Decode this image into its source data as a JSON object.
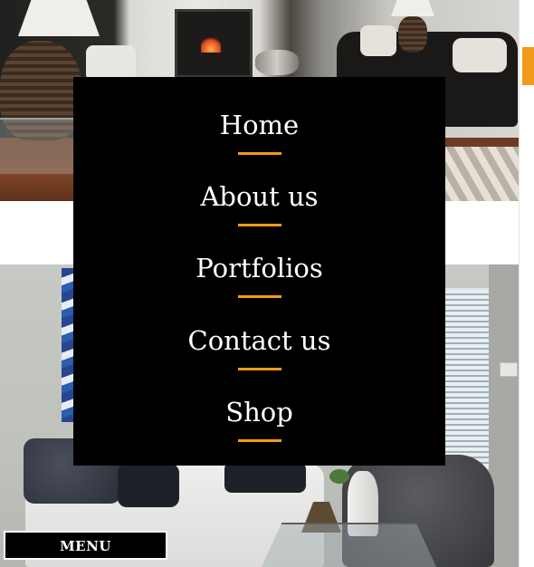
{
  "navigation": {
    "items": [
      {
        "label": "Home"
      },
      {
        "label": "About us"
      },
      {
        "label": "Portfolios"
      },
      {
        "label": "Contact us"
      },
      {
        "label": "Shop"
      }
    ],
    "underline_color": "#f39a1a",
    "background_color": "#000000"
  },
  "menu_toggle": {
    "label": "MENU"
  },
  "scrollbar": {
    "accent_color": "#f39a1a"
  },
  "gallery": {
    "images": [
      {
        "subject": "living-room-fireplace-photo"
      },
      {
        "subject": "living-room-sofa-photo"
      }
    ]
  }
}
